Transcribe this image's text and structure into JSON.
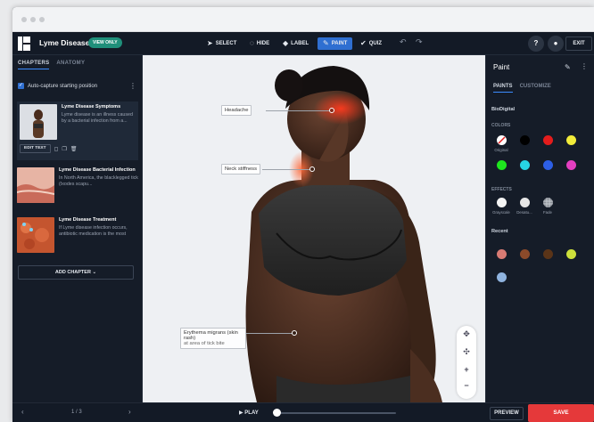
{
  "app": {
    "title": "Lyme Disease",
    "mode_badge": "VIEW ONLY"
  },
  "toolbar": {
    "tools": [
      {
        "label": "SELECT",
        "icon": "cursor-icon"
      },
      {
        "label": "HIDE",
        "icon": "eye-off-icon"
      },
      {
        "label": "LABEL",
        "icon": "tag-icon"
      },
      {
        "label": "PAINT",
        "icon": "brush-icon",
        "active": true
      },
      {
        "label": "QUIZ",
        "icon": "check-icon"
      }
    ],
    "help": "?",
    "exit": "EXIT"
  },
  "left_panel": {
    "tabs": [
      "CHAPTERS",
      "ANATOMY"
    ],
    "autocapture_label": "Auto-capture starting position",
    "chapters": [
      {
        "title": "Lyme Disease Symptoms",
        "description": "Lyme disease is an illness caused by a bacterial infection from a..."
      },
      {
        "title": "Lyme Disease Bacterial Infection",
        "description": "In North America, the blacklegged tick (Ixodes scapu..."
      },
      {
        "title": "Lyme Disease Treatment",
        "description": "If Lyme disease infection occurs, antibiotic medication is the most"
      }
    ],
    "edit_text": "EDIT TEXT",
    "add_chapter": "ADD CHAPTER"
  },
  "stage": {
    "labels": [
      "Headache",
      "Neck stiffness",
      "Erythema migrans (skin rash)",
      "at area of tick bite"
    ]
  },
  "right_panel": {
    "title": "Paint",
    "tabs": [
      "PAINTS",
      "CUSTOMIZE"
    ],
    "brand": "BioDigital",
    "colors_heading": "COLORS",
    "colors": [
      "#ffffff",
      "#000000",
      "#e41c1c",
      "#f2ec3a",
      "#1ee61e",
      "#27d4e4",
      "#2d5fe6",
      "#e43fc0"
    ],
    "original_label": "Original",
    "effects_heading": "EFFECTS",
    "effects": [
      "Grayscale",
      "Desatu...",
      "Fade"
    ],
    "recent_heading": "Recent",
    "recent_colors": [
      "#d87b74",
      "#8b4a2a",
      "#5a3418",
      "#cde03b",
      "#8fb3df"
    ]
  },
  "bottom": {
    "page": "1 / 3",
    "play": "PLAY",
    "preview": "PREVIEW",
    "save": "SAVE"
  }
}
